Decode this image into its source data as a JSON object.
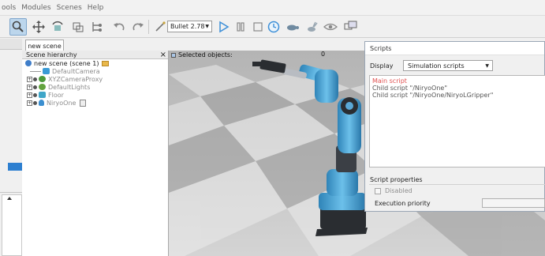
{
  "menu": [
    "ools",
    "Modules",
    "Scenes",
    "Help"
  ],
  "toolbar": {
    "engine": "Bullet 2.78"
  },
  "scene_tab": "new scene",
  "hierarchy": {
    "title": "Scene hierarchy",
    "close": "×",
    "items": [
      {
        "label": "new scene (scene 1)",
        "dim": false,
        "expander": "",
        "icon_name": "globe-icon",
        "icon_color": "#3f7ec9"
      },
      {
        "label": "DefaultCamera",
        "dim": true,
        "expander": "",
        "icon_name": "camera-icon",
        "icon_color": "#3a9bd6"
      },
      {
        "label": "XYZCameraProxy",
        "dim": true,
        "expander": "⊞",
        "icon_name": "shape-icon",
        "icon_color": "#4c9a3b"
      },
      {
        "label": "DefaultLights",
        "dim": true,
        "expander": "⊞",
        "icon_name": "light-icon",
        "icon_color": "#62a33e"
      },
      {
        "label": "Floor",
        "dim": true,
        "expander": "⊞",
        "icon_name": "cube-icon",
        "icon_color": "#3fa6c8"
      },
      {
        "label": "NiryoOne",
        "dim": true,
        "expander": "⊞",
        "icon_name": "robot-icon",
        "icon_color": "#3b8fd0"
      }
    ]
  },
  "viewport": {
    "selected_label": "Selected objects:",
    "counter": "0"
  },
  "scripts": {
    "title": "Scripts",
    "display_label": "Display",
    "display_value": "Simulation scripts",
    "items": [
      {
        "label": "Main script",
        "main": true
      },
      {
        "label": "Child script \"/NiryoOne\"",
        "main": false
      },
      {
        "label": "Child script \"/NiryoOne/NiryoLGripper\"",
        "main": false
      }
    ],
    "properties_title": "Script properties",
    "disabled_label": "Disabled",
    "execution_priority_label": "Execution priority"
  },
  "colors": {
    "accent": "#2d7fd0",
    "robot_blue": "#4aa6d8",
    "robot_dark": "#2a2d31",
    "main_script_red": "#e05050"
  }
}
